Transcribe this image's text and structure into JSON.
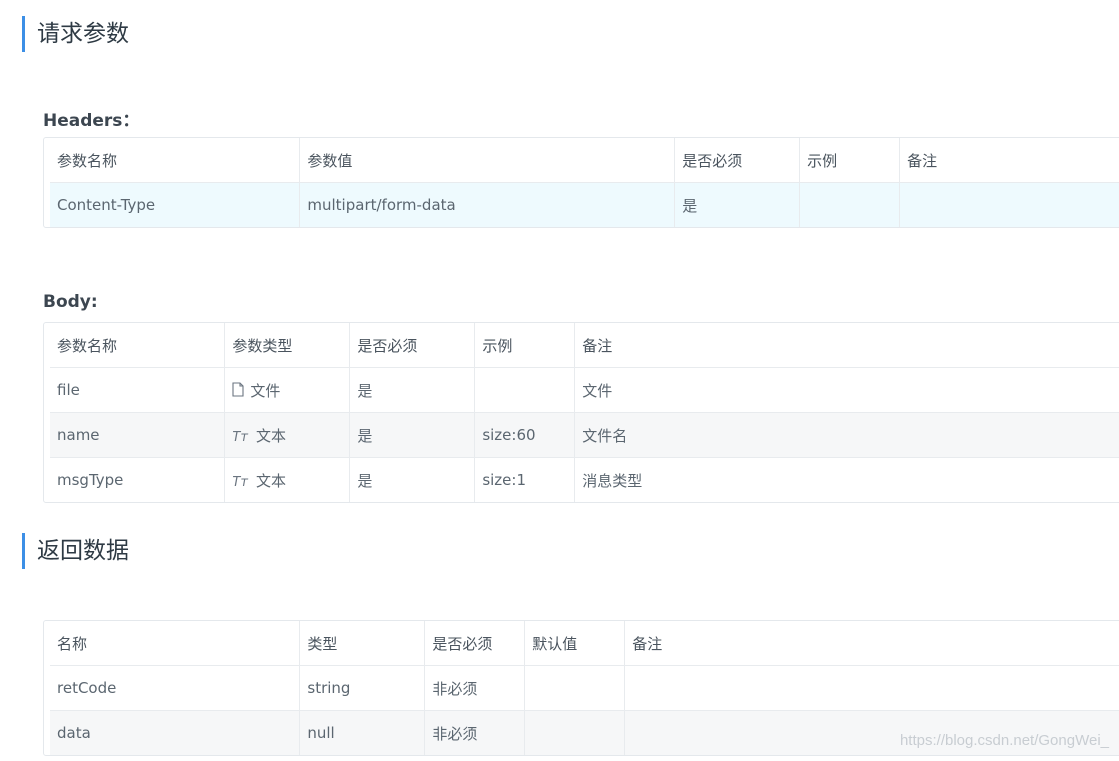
{
  "request": {
    "title": "请求参数",
    "headers_label": "Headers：",
    "headers_columns": [
      "参数名称",
      "参数值",
      "是否必须",
      "示例",
      "备注"
    ],
    "headers_rows": [
      [
        "Content-Type",
        "multipart/form-data",
        "是",
        "",
        ""
      ]
    ],
    "body_label": "Body:",
    "body_columns": [
      "参数名称",
      "参数类型",
      "是否必须",
      "示例",
      "备注"
    ],
    "body_rows": [
      {
        "name": "file",
        "type_icon": "file-icon",
        "type": "文件",
        "required": "是",
        "example": "",
        "note": "文件"
      },
      {
        "name": "name",
        "type_icon": "text-type-icon",
        "type": "文本",
        "required": "是",
        "example": "size:60",
        "note": "文件名"
      },
      {
        "name": "msgType",
        "type_icon": "text-type-icon",
        "type": "文本",
        "required": "是",
        "example": "size:1",
        "note": "消息类型"
      }
    ]
  },
  "response": {
    "title": "返回数据",
    "columns": [
      "名称",
      "类型",
      "是否必须",
      "默认值",
      "备注"
    ],
    "rows": [
      [
        "retCode",
        "string",
        "非必须",
        "",
        ""
      ],
      [
        "data",
        "null",
        "非必须",
        "",
        ""
      ]
    ]
  },
  "icons": {
    "text_type_glyph": "Tт"
  },
  "watermark": "https://blog.csdn.net/GongWei_",
  "colors": {
    "accent": "#3c8fe6",
    "highlight_row": "#eefafe",
    "alt_row": "#f6f7f8"
  }
}
